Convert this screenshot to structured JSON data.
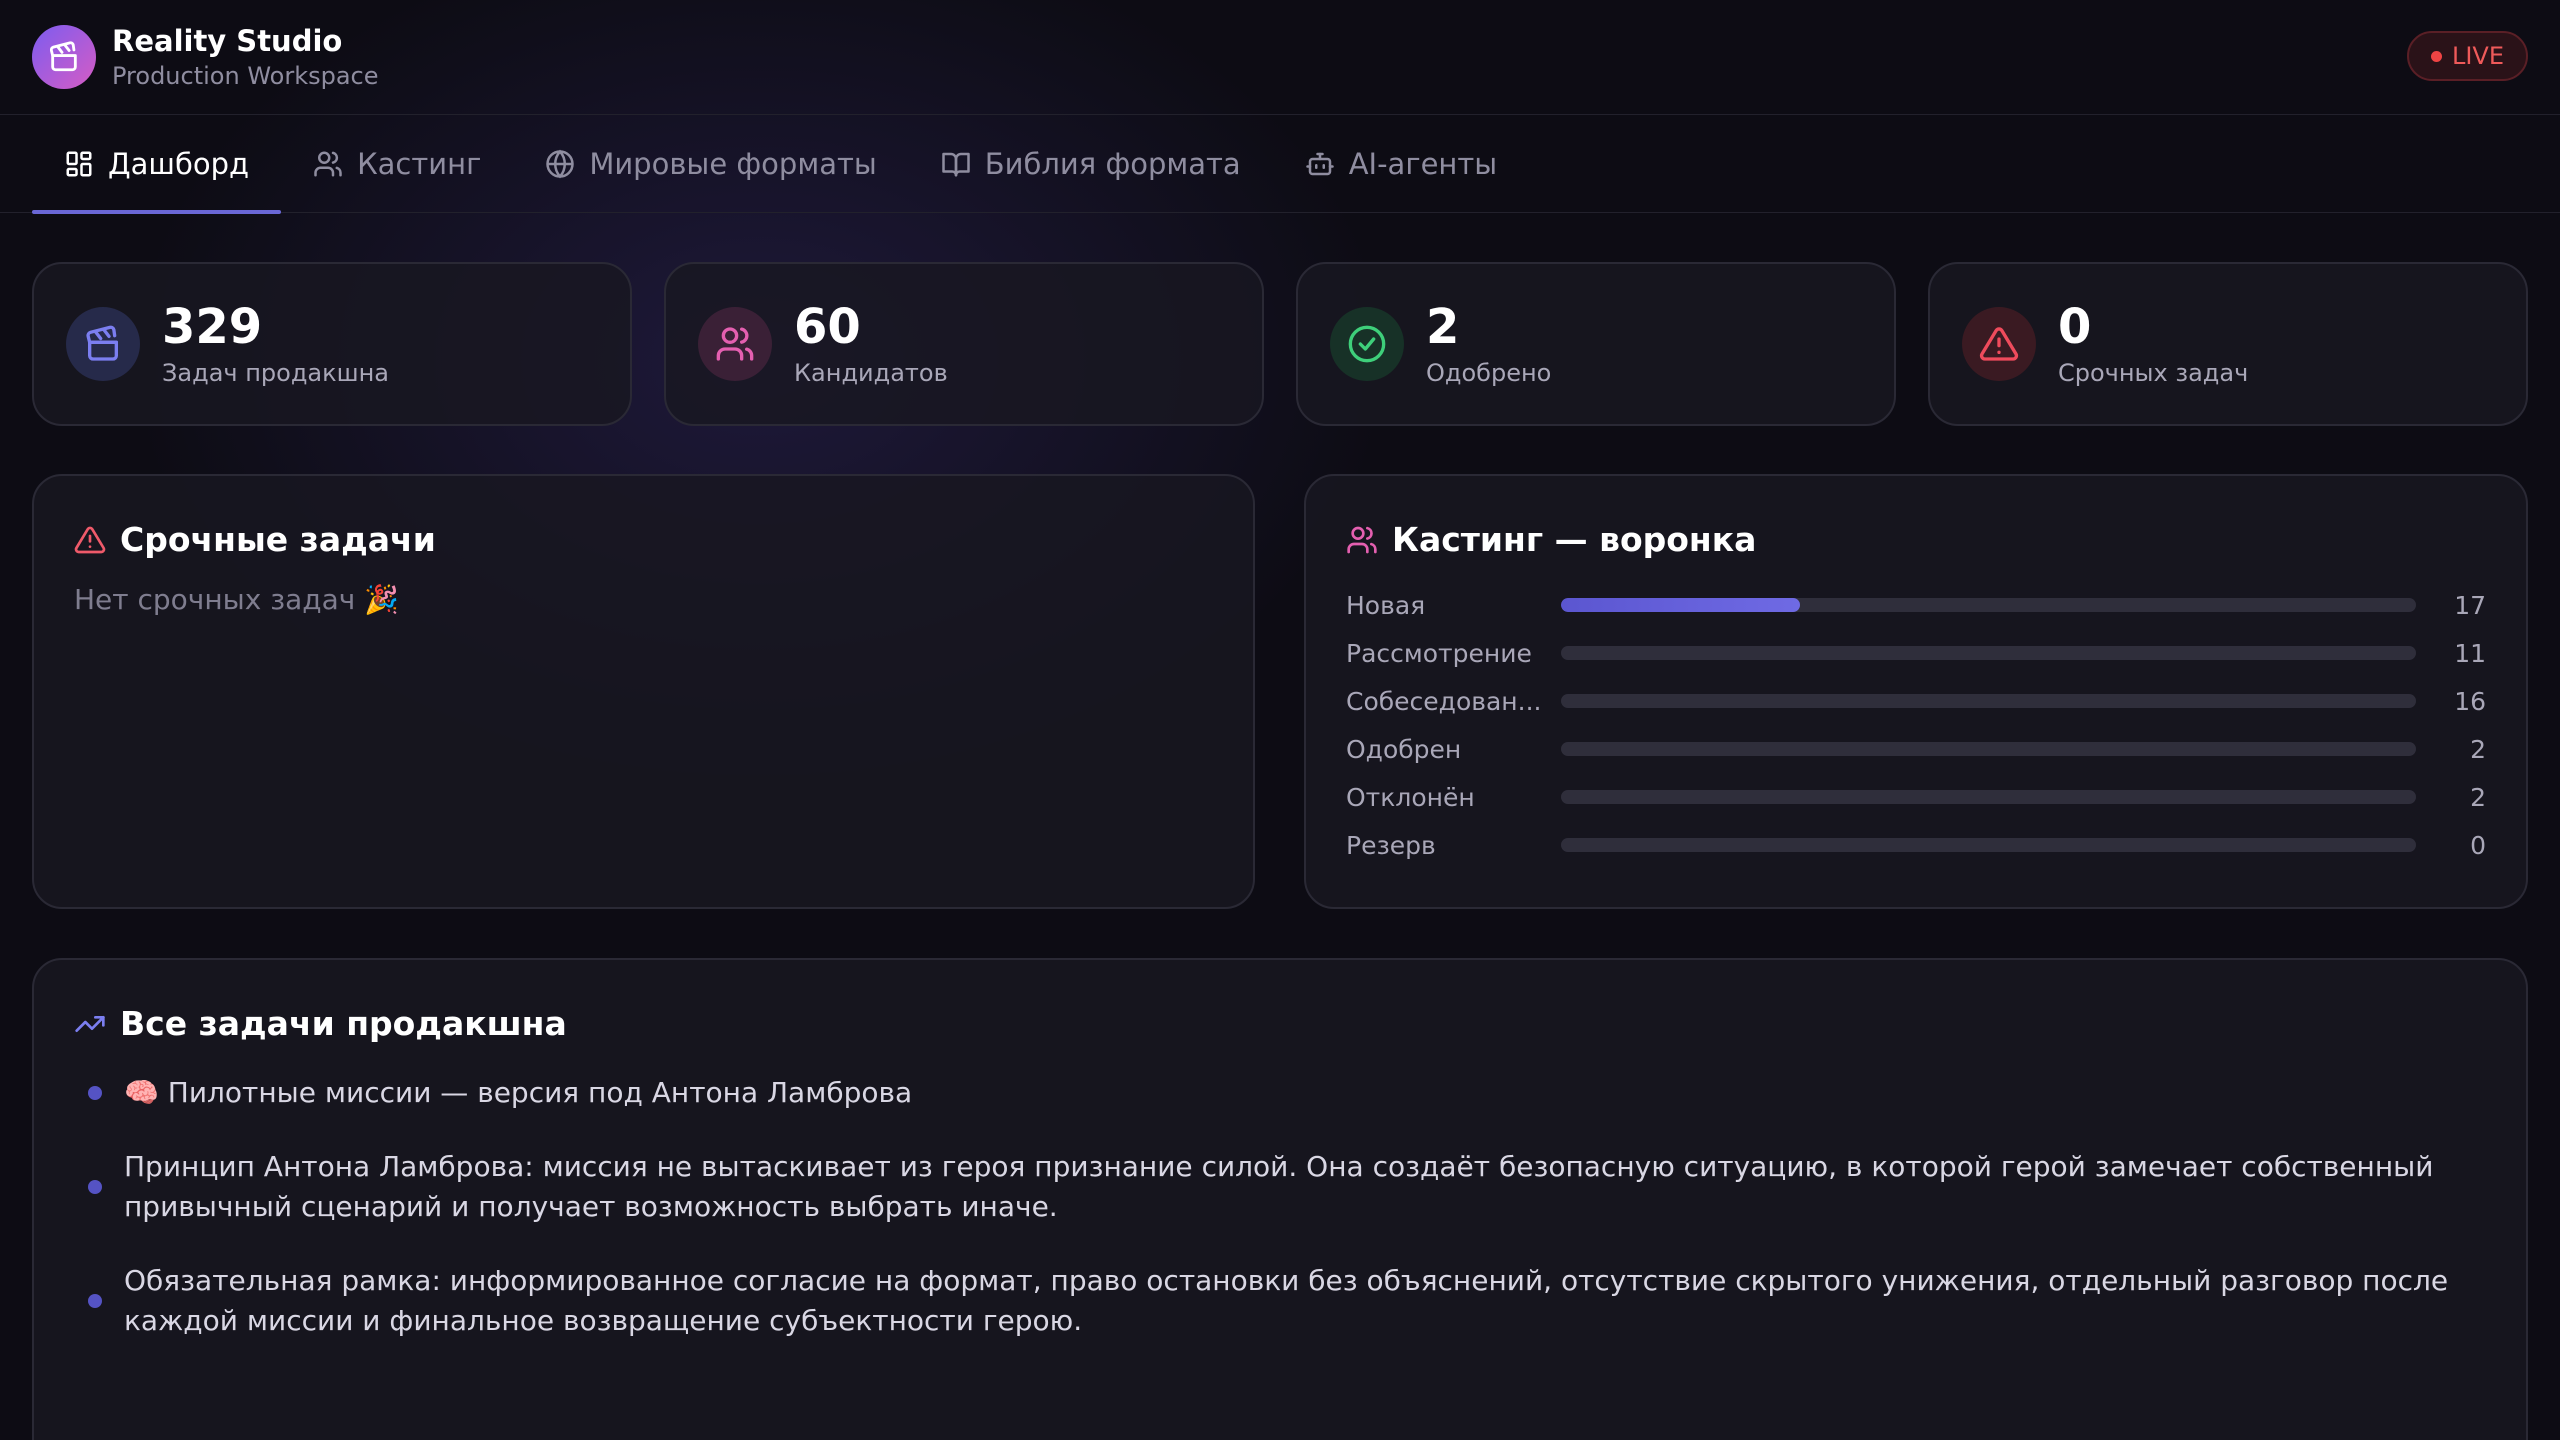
{
  "header": {
    "title": "Reality Studio",
    "subtitle": "Production Workspace",
    "live_label": "LIVE",
    "logo_icon": "clapperboard-icon"
  },
  "tabs": [
    {
      "label": "Дашборд",
      "icon": "dashboard-icon",
      "active": true
    },
    {
      "label": "Кастинг",
      "icon": "users-icon",
      "active": false
    },
    {
      "label": "Мировые форматы",
      "icon": "globe-icon",
      "active": false
    },
    {
      "label": "Библия формата",
      "icon": "book-icon",
      "active": false
    },
    {
      "label": "AI-агенты",
      "icon": "robot-icon",
      "active": false
    }
  ],
  "stats": [
    {
      "value": "329",
      "label": "Задач продакшна",
      "icon": "clapperboard-icon",
      "color": "#7b7ef0"
    },
    {
      "value": "60",
      "label": "Кандидатов",
      "icon": "users-icon",
      "color": "#e45fb0"
    },
    {
      "value": "2",
      "label": "Одобрено",
      "icon": "check-circle-icon",
      "color": "#3ecf7a"
    },
    {
      "value": "0",
      "label": "Срочных задач",
      "icon": "warning-icon",
      "color": "#ef4b5c"
    }
  ],
  "urgent": {
    "title": "Срочные задачи",
    "empty_text": "Нет срочных задач 🎉"
  },
  "funnel": {
    "title": "Кастинг — воронка",
    "rows": [
      {
        "label": "Новая",
        "value": 17,
        "fill": 0.28
      },
      {
        "label": "Рассмотрение",
        "value": 11,
        "fill": 0
      },
      {
        "label": "Собеседован...",
        "value": 16,
        "fill": 0
      },
      {
        "label": "Одобрен",
        "value": 2,
        "fill": 0
      },
      {
        "label": "Отклонён",
        "value": 2,
        "fill": 0
      },
      {
        "label": "Резерв",
        "value": 0,
        "fill": 0
      }
    ]
  },
  "tasks": {
    "title": "Все задачи продакшна",
    "items": [
      "🧠 Пилотные миссии — версия под Антона Ламброва",
      "Принцип Антона Ламброва: миссия не вытаскивает из героя признание силой. Она создаёт безопасную ситуацию, в которой герой замечает собственный привычный сценарий и получает возможность выбрать иначе.",
      "Обязательная рамка: информированное согласие на формат, право остановки без объяснений, отсутствие скрытого унижения, отдельный разговор после каждой миссии и финальное возвращение субъектности герою."
    ]
  }
}
